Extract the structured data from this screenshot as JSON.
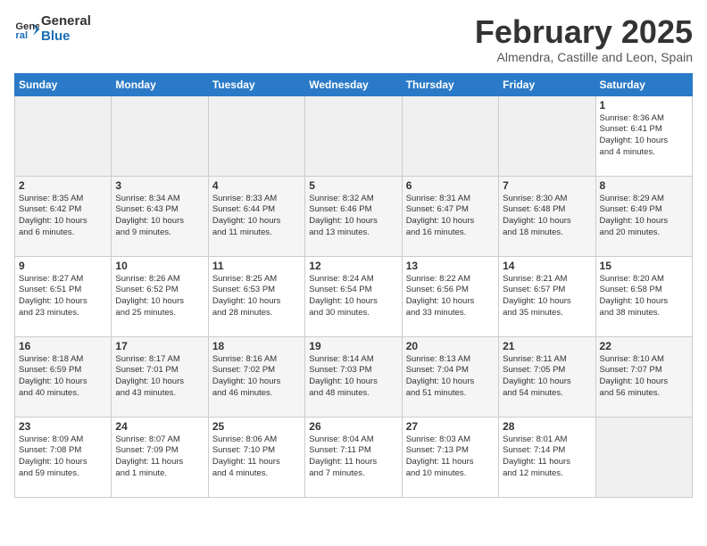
{
  "header": {
    "logo_line1": "General",
    "logo_line2": "Blue",
    "month": "February 2025",
    "location": "Almendra, Castille and Leon, Spain"
  },
  "days_of_week": [
    "Sunday",
    "Monday",
    "Tuesday",
    "Wednesday",
    "Thursday",
    "Friday",
    "Saturday"
  ],
  "weeks": [
    [
      {
        "day": "",
        "info": ""
      },
      {
        "day": "",
        "info": ""
      },
      {
        "day": "",
        "info": ""
      },
      {
        "day": "",
        "info": ""
      },
      {
        "day": "",
        "info": ""
      },
      {
        "day": "",
        "info": ""
      },
      {
        "day": "1",
        "info": "Sunrise: 8:36 AM\nSunset: 6:41 PM\nDaylight: 10 hours\nand 4 minutes."
      }
    ],
    [
      {
        "day": "2",
        "info": "Sunrise: 8:35 AM\nSunset: 6:42 PM\nDaylight: 10 hours\nand 6 minutes."
      },
      {
        "day": "3",
        "info": "Sunrise: 8:34 AM\nSunset: 6:43 PM\nDaylight: 10 hours\nand 9 minutes."
      },
      {
        "day": "4",
        "info": "Sunrise: 8:33 AM\nSunset: 6:44 PM\nDaylight: 10 hours\nand 11 minutes."
      },
      {
        "day": "5",
        "info": "Sunrise: 8:32 AM\nSunset: 6:46 PM\nDaylight: 10 hours\nand 13 minutes."
      },
      {
        "day": "6",
        "info": "Sunrise: 8:31 AM\nSunset: 6:47 PM\nDaylight: 10 hours\nand 16 minutes."
      },
      {
        "day": "7",
        "info": "Sunrise: 8:30 AM\nSunset: 6:48 PM\nDaylight: 10 hours\nand 18 minutes."
      },
      {
        "day": "8",
        "info": "Sunrise: 8:29 AM\nSunset: 6:49 PM\nDaylight: 10 hours\nand 20 minutes."
      }
    ],
    [
      {
        "day": "9",
        "info": "Sunrise: 8:27 AM\nSunset: 6:51 PM\nDaylight: 10 hours\nand 23 minutes."
      },
      {
        "day": "10",
        "info": "Sunrise: 8:26 AM\nSunset: 6:52 PM\nDaylight: 10 hours\nand 25 minutes."
      },
      {
        "day": "11",
        "info": "Sunrise: 8:25 AM\nSunset: 6:53 PM\nDaylight: 10 hours\nand 28 minutes."
      },
      {
        "day": "12",
        "info": "Sunrise: 8:24 AM\nSunset: 6:54 PM\nDaylight: 10 hours\nand 30 minutes."
      },
      {
        "day": "13",
        "info": "Sunrise: 8:22 AM\nSunset: 6:56 PM\nDaylight: 10 hours\nand 33 minutes."
      },
      {
        "day": "14",
        "info": "Sunrise: 8:21 AM\nSunset: 6:57 PM\nDaylight: 10 hours\nand 35 minutes."
      },
      {
        "day": "15",
        "info": "Sunrise: 8:20 AM\nSunset: 6:58 PM\nDaylight: 10 hours\nand 38 minutes."
      }
    ],
    [
      {
        "day": "16",
        "info": "Sunrise: 8:18 AM\nSunset: 6:59 PM\nDaylight: 10 hours\nand 40 minutes."
      },
      {
        "day": "17",
        "info": "Sunrise: 8:17 AM\nSunset: 7:01 PM\nDaylight: 10 hours\nand 43 minutes."
      },
      {
        "day": "18",
        "info": "Sunrise: 8:16 AM\nSunset: 7:02 PM\nDaylight: 10 hours\nand 46 minutes."
      },
      {
        "day": "19",
        "info": "Sunrise: 8:14 AM\nSunset: 7:03 PM\nDaylight: 10 hours\nand 48 minutes."
      },
      {
        "day": "20",
        "info": "Sunrise: 8:13 AM\nSunset: 7:04 PM\nDaylight: 10 hours\nand 51 minutes."
      },
      {
        "day": "21",
        "info": "Sunrise: 8:11 AM\nSunset: 7:05 PM\nDaylight: 10 hours\nand 54 minutes."
      },
      {
        "day": "22",
        "info": "Sunrise: 8:10 AM\nSunset: 7:07 PM\nDaylight: 10 hours\nand 56 minutes."
      }
    ],
    [
      {
        "day": "23",
        "info": "Sunrise: 8:09 AM\nSunset: 7:08 PM\nDaylight: 10 hours\nand 59 minutes."
      },
      {
        "day": "24",
        "info": "Sunrise: 8:07 AM\nSunset: 7:09 PM\nDaylight: 11 hours\nand 1 minute."
      },
      {
        "day": "25",
        "info": "Sunrise: 8:06 AM\nSunset: 7:10 PM\nDaylight: 11 hours\nand 4 minutes."
      },
      {
        "day": "26",
        "info": "Sunrise: 8:04 AM\nSunset: 7:11 PM\nDaylight: 11 hours\nand 7 minutes."
      },
      {
        "day": "27",
        "info": "Sunrise: 8:03 AM\nSunset: 7:13 PM\nDaylight: 11 hours\nand 10 minutes."
      },
      {
        "day": "28",
        "info": "Sunrise: 8:01 AM\nSunset: 7:14 PM\nDaylight: 11 hours\nand 12 minutes."
      },
      {
        "day": "",
        "info": ""
      }
    ]
  ]
}
